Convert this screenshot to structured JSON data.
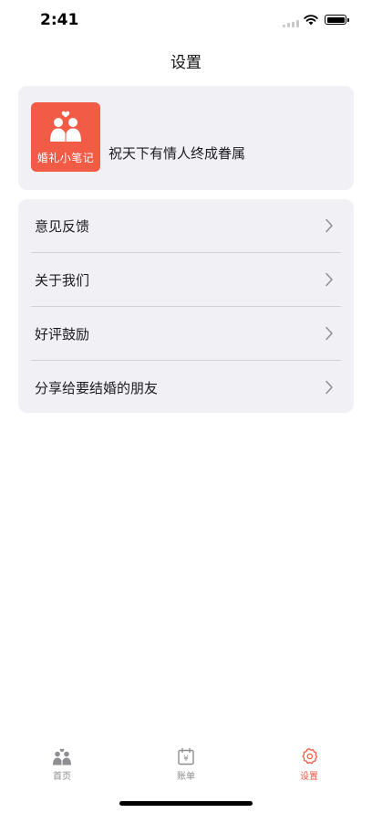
{
  "status_bar": {
    "time": "2:41"
  },
  "nav": {
    "title": "设置"
  },
  "profile": {
    "logo_text": "婚礼小笔记",
    "slogan": "祝天下有情人终成眷属"
  },
  "menu": {
    "items": [
      {
        "label": "意见反馈"
      },
      {
        "label": "关于我们"
      },
      {
        "label": "好评鼓励"
      },
      {
        "label": "分享给要结婚的朋友"
      }
    ]
  },
  "tab_bar": {
    "tabs": [
      {
        "label": "首页",
        "icon": "couple-icon"
      },
      {
        "label": "账单",
        "icon": "bill-calendar-icon"
      },
      {
        "label": "设置",
        "icon": "gear-icon",
        "active": true
      }
    ],
    "active_color": "#f25b45",
    "inactive_color": "#8e8e93"
  },
  "colors": {
    "accent": "#f25b45",
    "card_bg": "#f1f0f5"
  }
}
